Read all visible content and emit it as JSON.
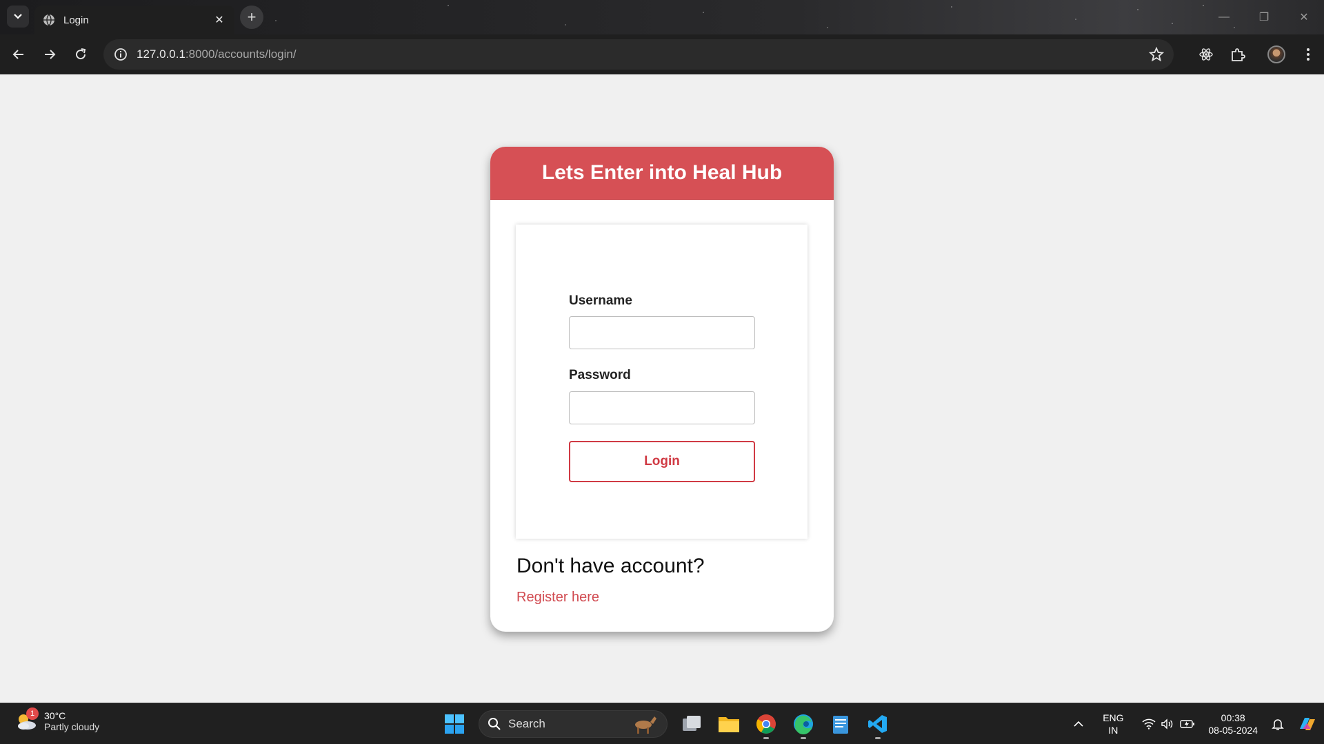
{
  "browser": {
    "tab_title": "Login",
    "url_host": "127.0.0.1",
    "url_rest": ":8000/accounts/login/"
  },
  "card": {
    "heading": "Lets Enter into Heal Hub",
    "username_label": "Username",
    "username_value": "",
    "password_label": "Password",
    "password_value": "",
    "login_button": "Login",
    "no_account_text": "Don't have account?",
    "register_link": "Register here"
  },
  "colors": {
    "header_red": "#d65055",
    "button_red": "#d03a44",
    "page_bg": "#f0f0f0"
  },
  "taskbar": {
    "weather_badge": "1",
    "weather_temp": "30°C",
    "weather_desc": "Partly cloudy",
    "search_label": "Search",
    "lang_top": "ENG",
    "lang_bottom": "IN",
    "time": "00:38",
    "date": "08-05-2024"
  }
}
